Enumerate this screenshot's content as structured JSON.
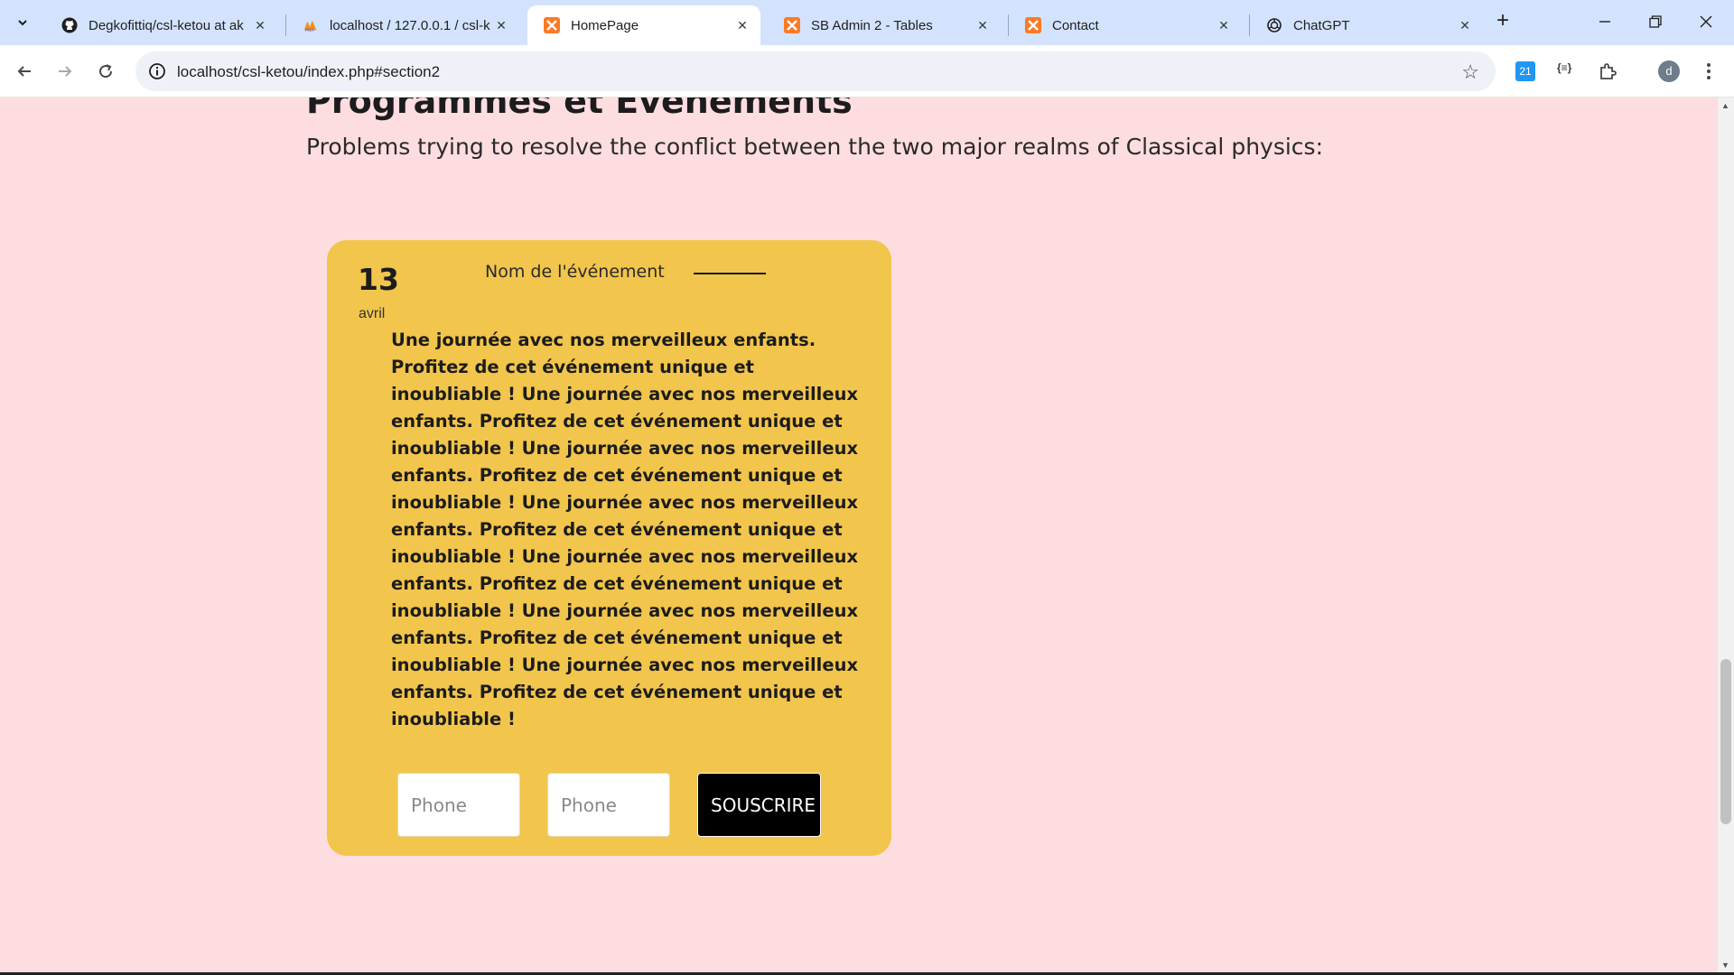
{
  "browser": {
    "tabs": [
      {
        "title": "Degkofittiq/csl-ketou at ak",
        "icon": "github-icon"
      },
      {
        "title": "localhost / 127.0.0.1 / csl-k",
        "icon": "phpmyadmin-icon"
      },
      {
        "title": "HomePage",
        "icon": "xampp-icon",
        "active": true
      },
      {
        "title": "SB Admin 2 - Tables",
        "icon": "xampp-icon"
      },
      {
        "title": "Contact",
        "icon": "xampp-icon"
      },
      {
        "title": "ChatGPT",
        "icon": "chatgpt-icon"
      }
    ],
    "address": "localhost/csl-ketou/index.php#section2",
    "profile_initial": "d",
    "extension_badge": "21",
    "extension_label": "{≡}"
  },
  "section": {
    "title": "Programmes et Evenements",
    "subtitle": "Problems trying to resolve the conflict between the two major realms of Classical physics:"
  },
  "event": {
    "day": "13",
    "month": "avril",
    "name": "Nom de l'événement",
    "description": "Une journée avec nos merveilleux enfants. Profitez de cet événement unique et inoubliable ! Une journée avec nos merveilleux enfants. Profitez de cet événement unique et inoubliable ! Une journée avec nos merveilleux enfants. Profitez de cet événement unique et inoubliable ! Une journée avec nos merveilleux enfants. Profitez de cet événement unique et inoubliable ! Une journée avec nos merveilleux enfants. Profitez de cet événement unique et inoubliable ! Une journée avec nos merveilleux enfants. Profitez de cet événement unique et inoubliable ! Une journée avec nos merveilleux enfants. Profitez de cet événement unique et inoubliable !",
    "input1_placeholder": "Phone",
    "input2_placeholder": "Phone",
    "subscribe_label": "SOUSCRIRE"
  },
  "colors": {
    "page_bg": "#fddde0",
    "card_bg": "#f2c54c",
    "button_bg": "#000000",
    "tabstrip_bg": "#d3e3fd"
  }
}
